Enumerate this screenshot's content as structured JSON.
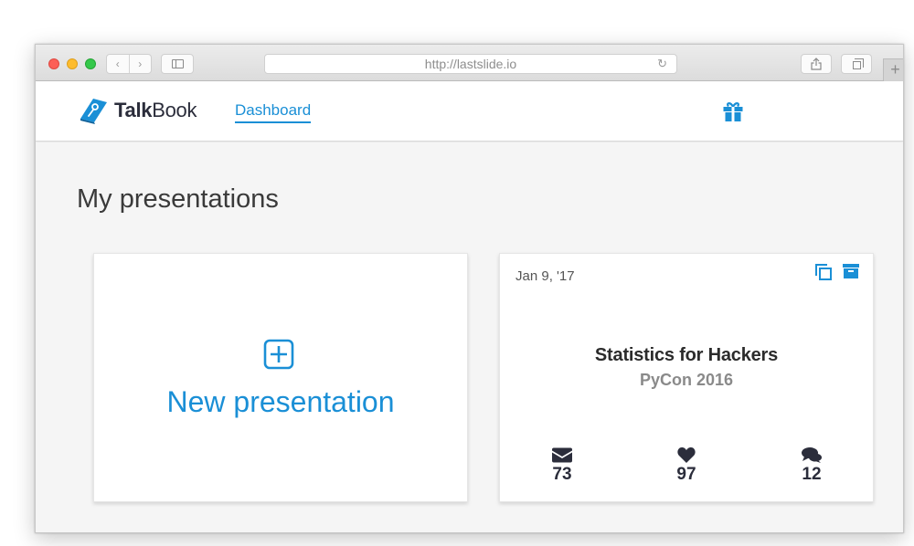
{
  "browser": {
    "url": "http://lastslide.io",
    "back_glyph": "‹",
    "forward_glyph": "›",
    "reload_glyph": "↻",
    "new_tab_glyph": "+",
    "icons": [
      "back-icon",
      "forward-icon",
      "sidebar-icon",
      "reload-icon",
      "share-icon",
      "tabs-icon",
      "new-tab-icon"
    ]
  },
  "header": {
    "logo_bold": "Talk",
    "logo_light": "Book",
    "nav": {
      "dashboard": "Dashboard"
    },
    "gift_icon": "gift-icon"
  },
  "main": {
    "title": "My presentations",
    "new_card": {
      "label": "New presentation",
      "icon": "plus-square-icon"
    },
    "presentations": [
      {
        "date": "Jan 9, '17",
        "title": "Statistics for Hackers",
        "subtitle": "PyCon 2016",
        "stats": {
          "mail": "73",
          "likes": "97",
          "comments": "12"
        }
      }
    ]
  },
  "colors": {
    "accent": "#1a8fd6",
    "text_dark": "#2b2d3b",
    "subtitle": "#8a8a8a"
  }
}
